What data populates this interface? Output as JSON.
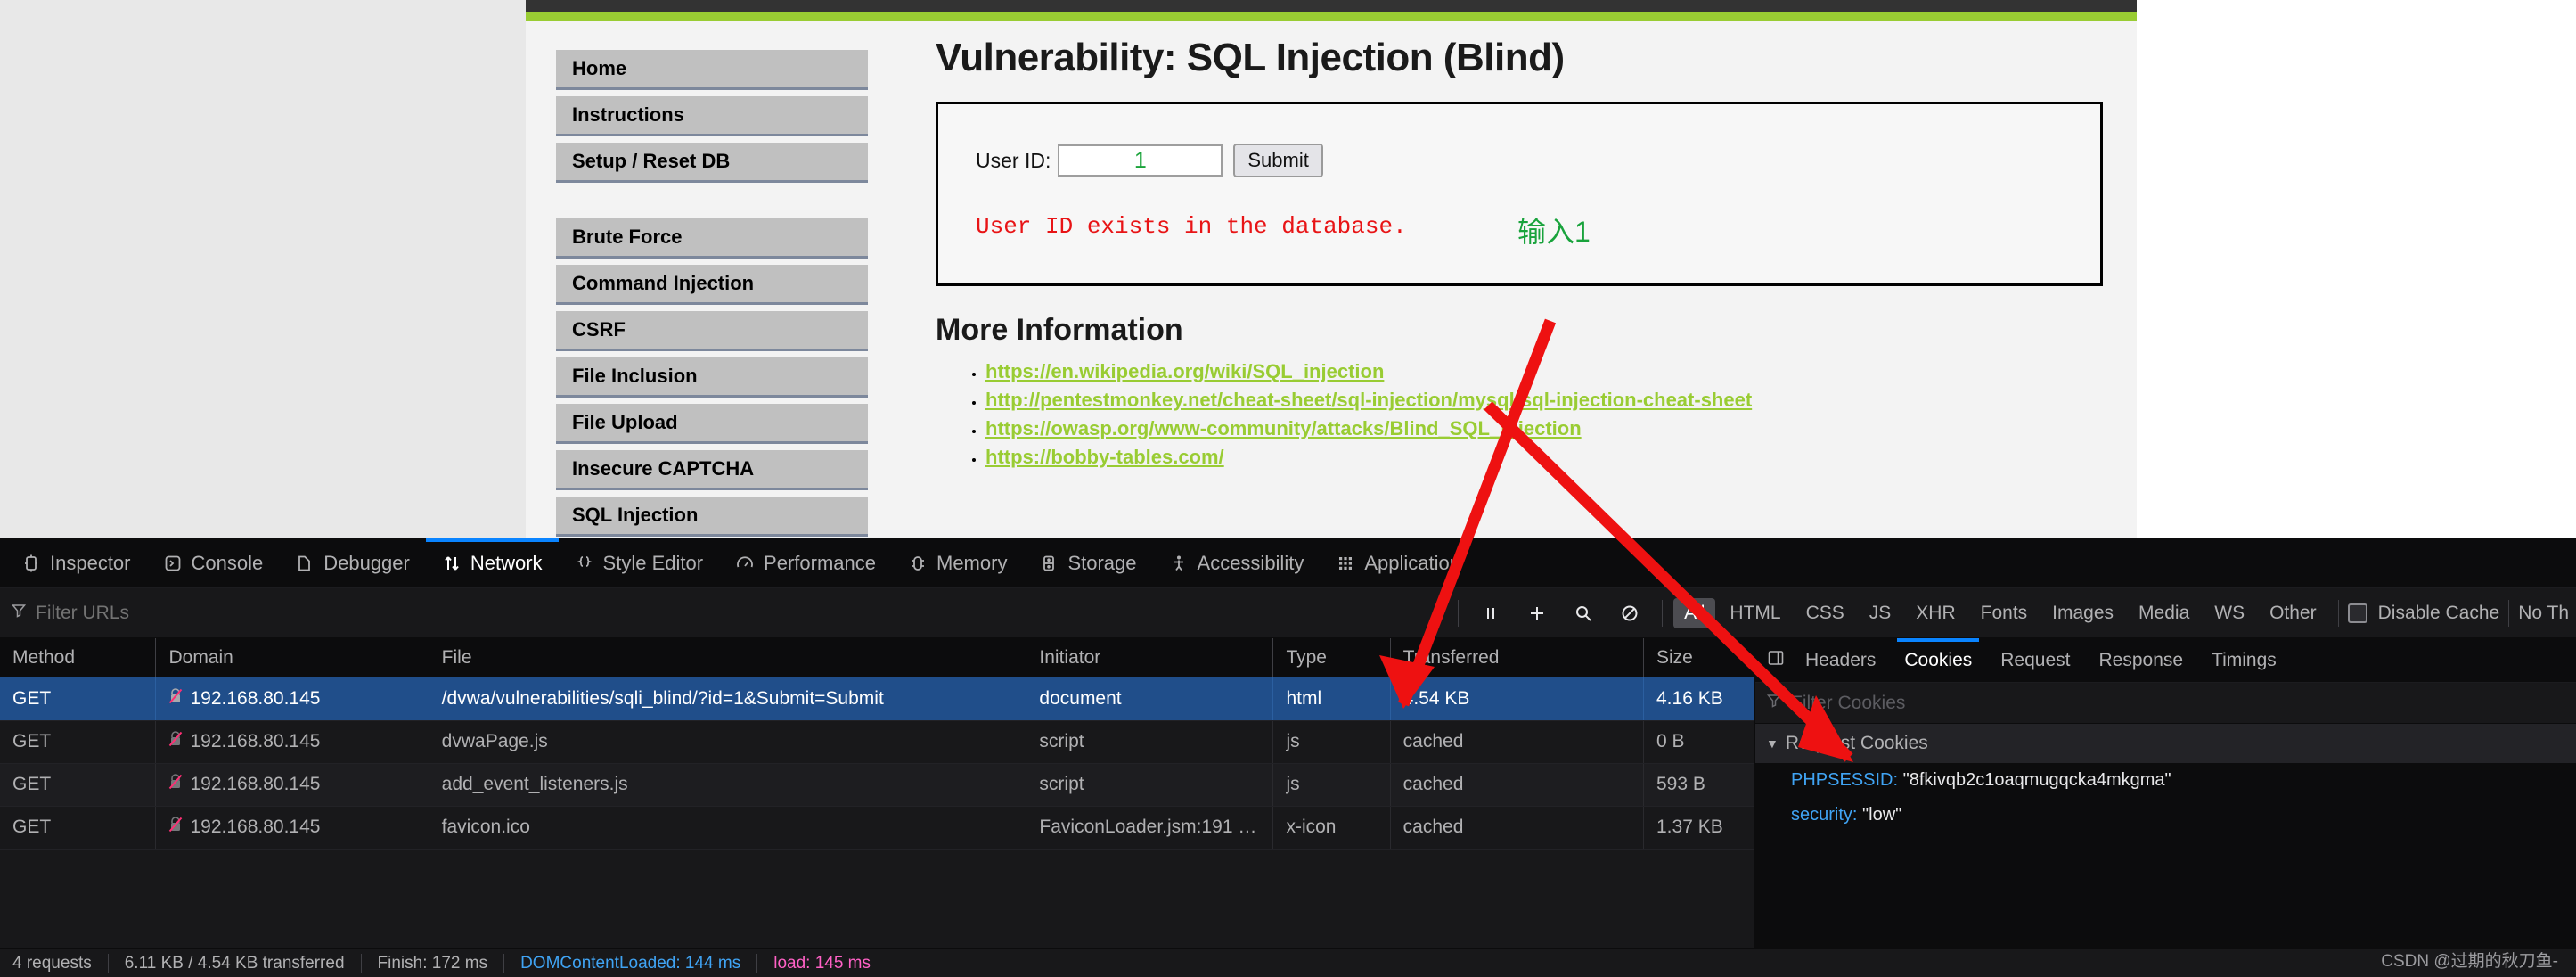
{
  "browser_page": {
    "nav_items": [
      {
        "label": "Home"
      },
      {
        "label": "Instructions"
      },
      {
        "label": "Setup / Reset DB"
      },
      {
        "label": "Brute Force"
      },
      {
        "label": "Command Injection"
      },
      {
        "label": "CSRF"
      },
      {
        "label": "File Inclusion"
      },
      {
        "label": "File Upload"
      },
      {
        "label": "Insecure CAPTCHA"
      },
      {
        "label": "SQL Injection"
      }
    ],
    "page_title": "Vulnerability: SQL Injection (Blind)",
    "form": {
      "user_id_label": "User ID:",
      "user_id_value": "1",
      "submit_label": "Submit",
      "result_message": "User ID exists in the database.",
      "annotation_note": "输入1"
    },
    "more_information": {
      "heading": "More Information",
      "links": [
        "https://en.wikipedia.org/wiki/SQL_injection",
        "http://pentestmonkey.net/cheat-sheet/sql-injection/mysql-sql-injection-cheat-sheet",
        "https://owasp.org/www-community/attacks/Blind_SQL_Injection",
        "https://bobby-tables.com/"
      ]
    }
  },
  "devtools": {
    "tabs": [
      {
        "label": "Inspector",
        "icon": "inspector-icon",
        "active": false
      },
      {
        "label": "Console",
        "icon": "console-icon",
        "active": false
      },
      {
        "label": "Debugger",
        "icon": "debugger-icon",
        "active": false
      },
      {
        "label": "Network",
        "icon": "network-icon",
        "active": true
      },
      {
        "label": "Style Editor",
        "icon": "style-editor-icon",
        "active": false
      },
      {
        "label": "Performance",
        "icon": "performance-icon",
        "active": false
      },
      {
        "label": "Memory",
        "icon": "memory-icon",
        "active": false
      },
      {
        "label": "Storage",
        "icon": "storage-icon",
        "active": false
      },
      {
        "label": "Accessibility",
        "icon": "accessibility-icon",
        "active": false
      },
      {
        "label": "Application",
        "icon": "application-icon",
        "active": false
      }
    ],
    "options_bar": {
      "filter_placeholder": "Filter URLs",
      "type_filters": [
        {
          "label": "All",
          "selected": true
        },
        {
          "label": "HTML",
          "selected": false
        },
        {
          "label": "CSS",
          "selected": false
        },
        {
          "label": "JS",
          "selected": false
        },
        {
          "label": "XHR",
          "selected": false
        },
        {
          "label": "Fonts",
          "selected": false
        },
        {
          "label": "Images",
          "selected": false
        },
        {
          "label": "Media",
          "selected": false
        },
        {
          "label": "WS",
          "selected": false
        },
        {
          "label": "Other",
          "selected": false
        }
      ],
      "disable_cache_label": "Disable Cache",
      "throttling_label": "No Th"
    },
    "network_table": {
      "columns": [
        "Method",
        "Domain",
        "File",
        "Initiator",
        "Type",
        "Transferred",
        "Size"
      ],
      "rows": [
        {
          "method": "GET",
          "domain": "192.168.80.145",
          "file": "/dvwa/vulnerabilities/sqli_blind/?id=1&Submit=Submit",
          "initiator": "document",
          "type": "html",
          "transferred": "4.54 KB",
          "size": "4.16 KB",
          "selected": true,
          "initiator_is_link": false
        },
        {
          "method": "GET",
          "domain": "192.168.80.145",
          "file": "dvwaPage.js",
          "initiator": "script",
          "type": "js",
          "transferred": "cached",
          "size": "0 B",
          "selected": false,
          "initiator_is_link": false
        },
        {
          "method": "GET",
          "domain": "192.168.80.145",
          "file": "add_event_listeners.js",
          "initiator": "script",
          "type": "js",
          "transferred": "cached",
          "size": "593 B",
          "selected": false,
          "initiator_is_link": false
        },
        {
          "method": "GET",
          "domain": "192.168.80.145",
          "file": "favicon.ico",
          "initiator": "FaviconLoader.jsm:191 …",
          "type": "x-icon",
          "transferred": "cached",
          "size": "1.37 KB",
          "selected": false,
          "initiator_is_link": true
        }
      ]
    },
    "details_pane": {
      "tabs": [
        {
          "label": "Headers",
          "active": false
        },
        {
          "label": "Cookies",
          "active": true
        },
        {
          "label": "Request",
          "active": false
        },
        {
          "label": "Response",
          "active": false
        },
        {
          "label": "Timings",
          "active": false
        }
      ],
      "filter_placeholder": "Filter Cookies",
      "section_title": "Request Cookies",
      "cookies": [
        {
          "name": "PHPSESSID:",
          "value": "\"8fkivqb2c1oaqmugqcka4mkgma\""
        },
        {
          "name": "security:",
          "value": "\"low\""
        }
      ]
    },
    "status_bar": {
      "requests": "4 requests",
      "transferred": "6.11 KB / 4.54 KB transferred",
      "finish": "Finish: 172 ms",
      "dom_content_loaded": "DOMContentLoaded: 144 ms",
      "load": "load: 145 ms"
    }
  },
  "watermark": "CSDN @过期的秋刀鱼-",
  "colors": {
    "accent_blue": "#0a84ff",
    "dvwa_green": "#99cc33",
    "error_red": "#e81416",
    "selection_blue": "#204e8a",
    "annotation_red": "#ee1111"
  }
}
